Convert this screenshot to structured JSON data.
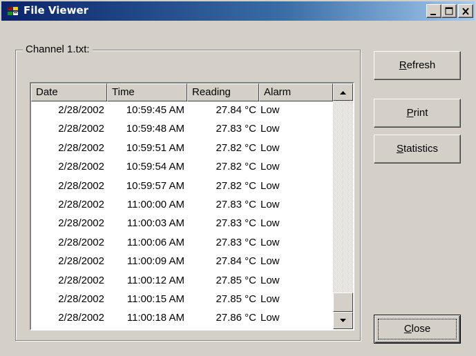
{
  "window": {
    "title": "File Viewer",
    "caption_buttons": [
      "minimize-icon",
      "maximize-icon",
      "close-icon"
    ]
  },
  "group": {
    "label": "Channel 1.txt:"
  },
  "table": {
    "columns": [
      "Date",
      "Time",
      "Reading",
      "Alarm"
    ],
    "rows": [
      [
        "2/28/2002",
        "10:59:45 AM",
        "27.84 °C",
        "Low"
      ],
      [
        "2/28/2002",
        "10:59:48 AM",
        "27.83 °C",
        "Low"
      ],
      [
        "2/28/2002",
        "10:59:51 AM",
        "27.82 °C",
        "Low"
      ],
      [
        "2/28/2002",
        "10:59:54 AM",
        "27.82 °C",
        "Low"
      ],
      [
        "2/28/2002",
        "10:59:57 AM",
        "27.82 °C",
        "Low"
      ],
      [
        "2/28/2002",
        "11:00:00 AM",
        "27.83 °C",
        "Low"
      ],
      [
        "2/28/2002",
        "11:00:03 AM",
        "27.83 °C",
        "Low"
      ],
      [
        "2/28/2002",
        "11:00:06 AM",
        "27.83 °C",
        "Low"
      ],
      [
        "2/28/2002",
        "11:00:09 AM",
        "27.84 °C",
        "Low"
      ],
      [
        "2/28/2002",
        "11:00:12 AM",
        "27.85 °C",
        "Low"
      ],
      [
        "2/28/2002",
        "11:00:15 AM",
        "27.85 °C",
        "Low"
      ],
      [
        "2/28/2002",
        "11:00:18 AM",
        "27.86 °C",
        "Low"
      ]
    ],
    "scroll_position": 1.0
  },
  "buttons": {
    "refresh": {
      "accel": "R",
      "rest": "efresh"
    },
    "print": {
      "accel": "P",
      "rest": "rint"
    },
    "statistics": {
      "accel": "S",
      "rest": "tatistics"
    },
    "close": {
      "accel": "C",
      "rest": "lose"
    }
  },
  "colors": {
    "titlebar_start": "#0a246a",
    "titlebar_end": "#a6caf0",
    "face": "#d4d0c8"
  }
}
